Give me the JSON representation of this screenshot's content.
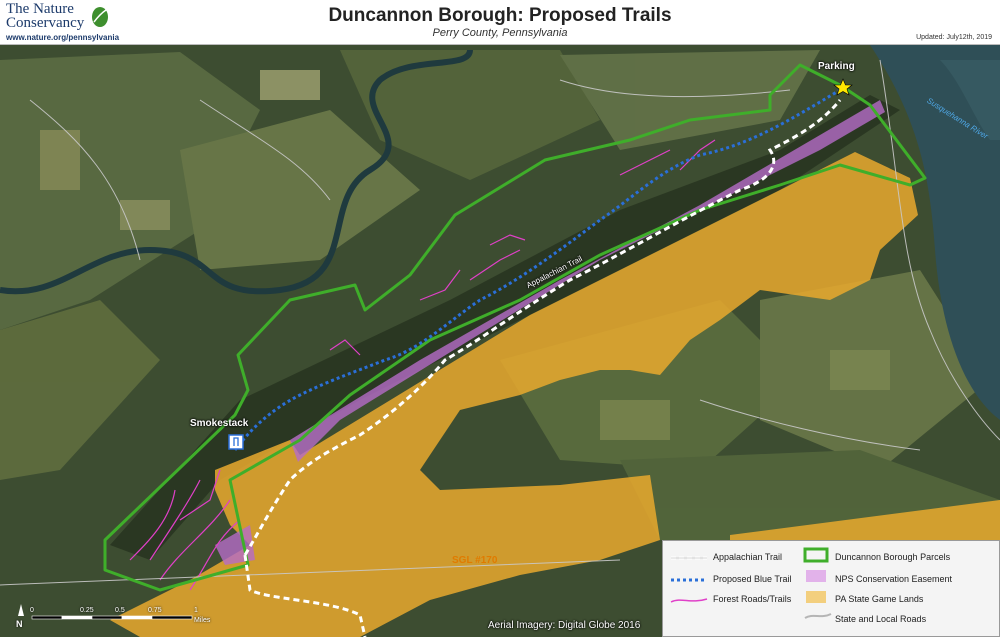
{
  "header": {
    "org_line1": "The Nature",
    "org_line2": "Conservancy",
    "org_url": "www.nature.org/pennsylvania",
    "title": "Duncannon Borough: Proposed Trails",
    "subtitle": "Perry County, Pennsylvania",
    "updated": "Updated: July12th, 2019"
  },
  "map_labels": {
    "parking": "Parking",
    "smokestack": "Smokestack",
    "appalachian": "Appalachian Trail",
    "river": "Susquehanna River",
    "sgl": "SGL #170"
  },
  "legend": {
    "items": [
      {
        "label": "Appalachian Trail",
        "symbol": "white-dashed-line"
      },
      {
        "label": "Proposed Blue Trail",
        "symbol": "blue-dotted-line"
      },
      {
        "label": "Forest Roads/Trails",
        "symbol": "magenta-line"
      },
      {
        "label": "Duncannon Borough Parcels",
        "symbol": "green-outline"
      },
      {
        "label": "NPS Conservation Easement",
        "symbol": "purple-fill"
      },
      {
        "label": "PA State Game Lands",
        "symbol": "gold-fill"
      },
      {
        "label": "State and Local Roads",
        "symbol": "grey-line"
      }
    ]
  },
  "scale": {
    "north": "N",
    "ticks": [
      "0",
      "0.25",
      "0.5",
      "0.75",
      "1"
    ],
    "unit": "Miles"
  },
  "credit": "Aerial Imagery: Digital Globe 2016",
  "colors": {
    "parcel_outline": "#3fae2a",
    "easement": "#b56bc8",
    "game_lands": "#e9a92e",
    "blue_trail": "#2a6fd8",
    "forest_roads": "#e040c8",
    "river": "#2f4f57"
  }
}
